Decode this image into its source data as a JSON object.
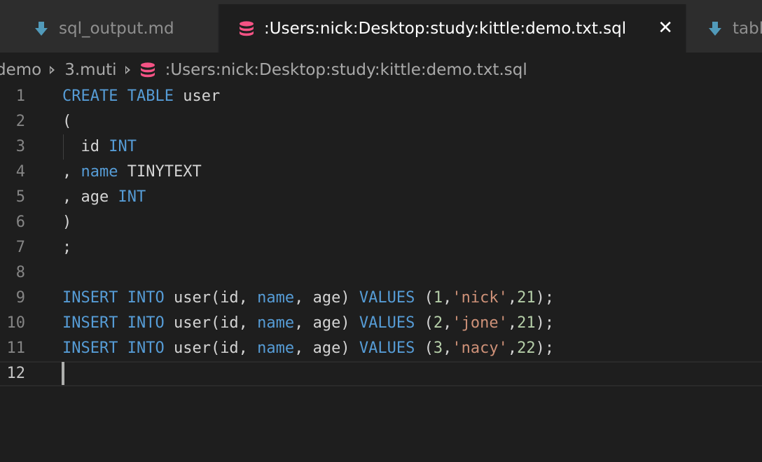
{
  "tabs": [
    {
      "label": "sql_output.md",
      "icon": "markdown-download-icon",
      "active": false
    },
    {
      "label": ":Users:nick:Desktop:study:kittle:demo.txt.sql",
      "icon": "database-icon",
      "active": true,
      "close_glyph": "✕"
    },
    {
      "label": "tabl",
      "icon": "markdown-download-icon",
      "active": false
    }
  ],
  "breadcrumb": {
    "items": [
      "demo",
      "3.muti",
      ":Users:nick:Desktop:study:kittle:demo.txt.sql"
    ]
  },
  "editor": {
    "current_line": 12,
    "lines": [
      {
        "n": "1",
        "tokens": [
          [
            "kw",
            "CREATE"
          ],
          [
            "id",
            " "
          ],
          [
            "kw",
            "TABLE"
          ],
          [
            "id",
            " user"
          ]
        ]
      },
      {
        "n": "2",
        "tokens": [
          [
            "id",
            "("
          ]
        ]
      },
      {
        "n": "3",
        "tokens": [
          [
            "id",
            "  id "
          ],
          [
            "kw",
            "INT"
          ]
        ]
      },
      {
        "n": "4",
        "tokens": [
          [
            "id",
            ", "
          ],
          [
            "kw",
            "name"
          ],
          [
            "id",
            " TINYTEXT"
          ]
        ]
      },
      {
        "n": "5",
        "tokens": [
          [
            "id",
            ", age "
          ],
          [
            "kw",
            "INT"
          ]
        ]
      },
      {
        "n": "6",
        "tokens": [
          [
            "id",
            ")"
          ]
        ]
      },
      {
        "n": "7",
        "tokens": [
          [
            "id",
            ";"
          ]
        ]
      },
      {
        "n": "8",
        "tokens": []
      },
      {
        "n": "9",
        "tokens": [
          [
            "kw",
            "INSERT"
          ],
          [
            "id",
            " "
          ],
          [
            "kw",
            "INTO"
          ],
          [
            "id",
            " user(id, "
          ],
          [
            "kw",
            "name"
          ],
          [
            "id",
            ", age) "
          ],
          [
            "kw",
            "VALUES"
          ],
          [
            "id",
            " ("
          ],
          [
            "num",
            "1"
          ],
          [
            "id",
            ","
          ],
          [
            "str",
            "'nick'"
          ],
          [
            "id",
            ","
          ],
          [
            "num",
            "21"
          ],
          [
            "id",
            ");"
          ]
        ]
      },
      {
        "n": "10",
        "tokens": [
          [
            "kw",
            "INSERT"
          ],
          [
            "id",
            " "
          ],
          [
            "kw",
            "INTO"
          ],
          [
            "id",
            " user(id, "
          ],
          [
            "kw",
            "name"
          ],
          [
            "id",
            ", age) "
          ],
          [
            "kw",
            "VALUES"
          ],
          [
            "id",
            " ("
          ],
          [
            "num",
            "2"
          ],
          [
            "id",
            ","
          ],
          [
            "str",
            "'jone'"
          ],
          [
            "id",
            ","
          ],
          [
            "num",
            "21"
          ],
          [
            "id",
            ");"
          ]
        ]
      },
      {
        "n": "11",
        "tokens": [
          [
            "kw",
            "INSERT"
          ],
          [
            "id",
            " "
          ],
          [
            "kw",
            "INTO"
          ],
          [
            "id",
            " user(id, "
          ],
          [
            "kw",
            "name"
          ],
          [
            "id",
            ", age) "
          ],
          [
            "kw",
            "VALUES"
          ],
          [
            "id",
            " ("
          ],
          [
            "num",
            "3"
          ],
          [
            "id",
            ","
          ],
          [
            "str",
            "'nacy'"
          ],
          [
            "id",
            ","
          ],
          [
            "num",
            "22"
          ],
          [
            "id",
            ");"
          ]
        ]
      },
      {
        "n": "12",
        "tokens": []
      }
    ]
  },
  "colors": {
    "keyword": "#569cd6",
    "string": "#ce9178",
    "number": "#b5cea8",
    "text": "#d4d4d4",
    "markdown_icon": "#519aba",
    "database_icon": "#f55385"
  }
}
